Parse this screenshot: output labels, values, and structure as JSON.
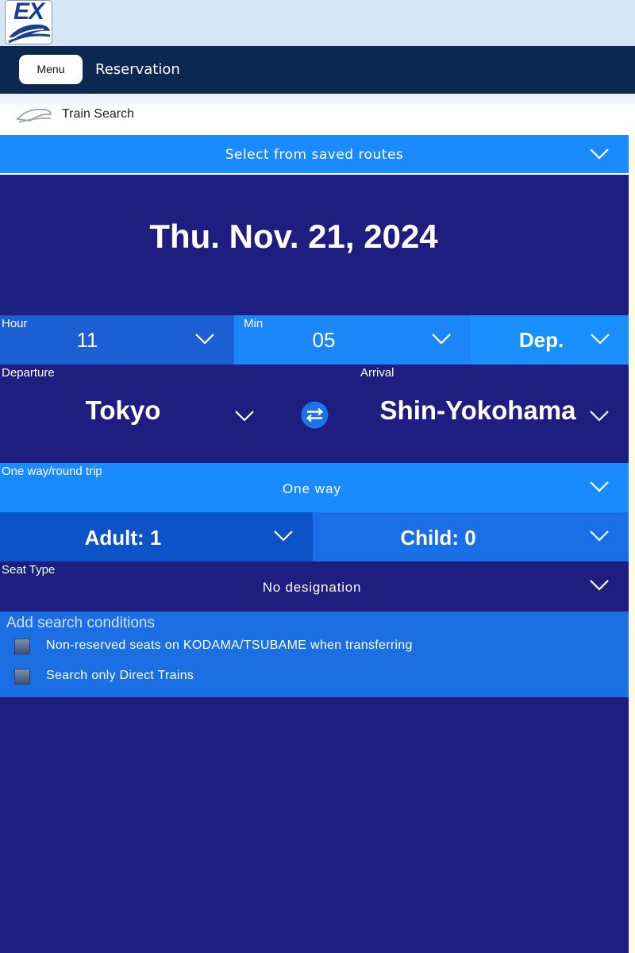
{
  "app": {
    "logo_text": "EX"
  },
  "nav": {
    "menu_label": "Menu",
    "title": "Reservation"
  },
  "breadcrumb": {
    "label": "Train Search",
    "icon": "train-icon"
  },
  "saved_routes": {
    "label": "Select from saved routes"
  },
  "date": {
    "value": "Thu. Nov. 21, 2024"
  },
  "time": {
    "hour_label": "Hour",
    "hour_value": "11",
    "min_label": "Min",
    "min_value": "05",
    "mode_value": "Dep."
  },
  "stations": {
    "departure_label": "Departure",
    "departure_value": "Tokyo",
    "arrival_label": "Arrival",
    "arrival_value": "Shin-Yokohama",
    "swap_icon": "swap-icon"
  },
  "trip": {
    "label": "One way/round trip",
    "value": "One way"
  },
  "passengers": {
    "adult": "Adult: 1",
    "child": "Child: 0"
  },
  "seat": {
    "label": "Seat Type",
    "value": "No designation"
  },
  "conditions": {
    "title": "Add search conditions",
    "options": [
      {
        "label": "Non-reserved seats on KODAMA/TSUBAME when transferring",
        "checked": false
      },
      {
        "label": "Search only Direct Trains",
        "checked": false
      }
    ]
  },
  "colors": {
    "navy": "#1d1e7f",
    "bright_blue": "#1a8bff",
    "mid_blue": "#1c5fd4",
    "header_dark": "#0b2850"
  }
}
